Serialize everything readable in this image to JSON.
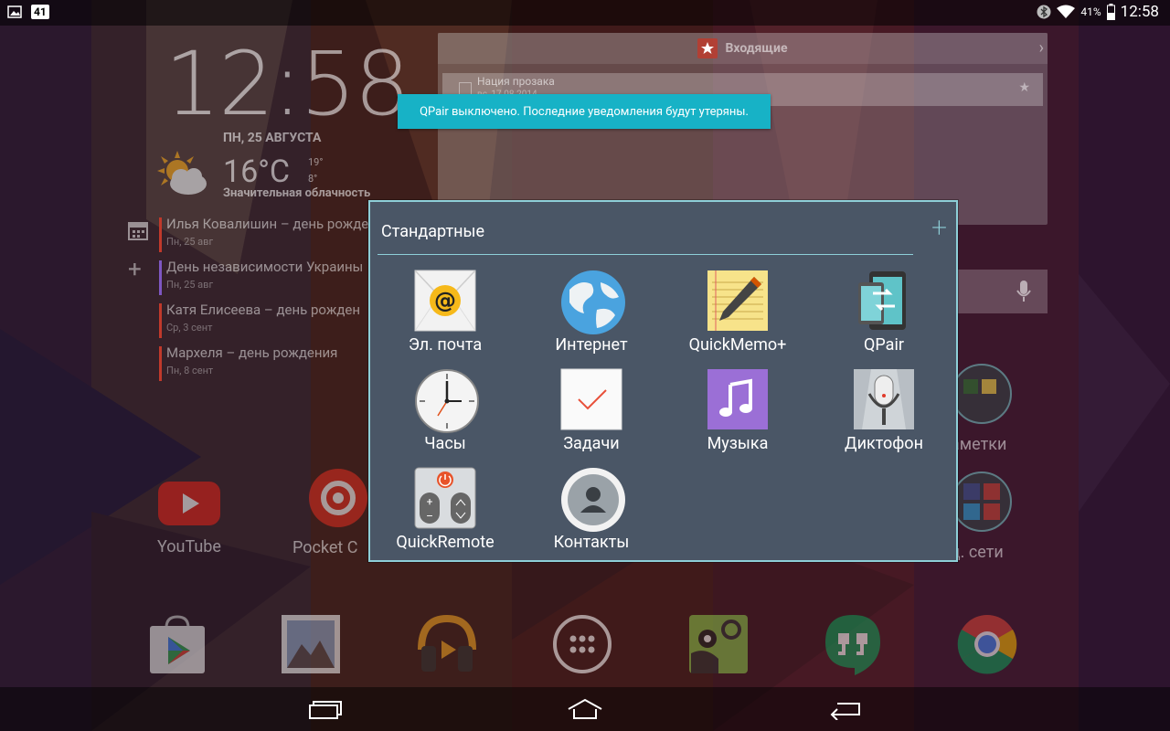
{
  "status_bar": {
    "notification_count": "41",
    "battery": "41%",
    "time": "12:58"
  },
  "clock_widget": {
    "time": "12:58",
    "date": "ПН, 25 АВГУСТА",
    "temperature": "16°C",
    "temp_high": "19°",
    "temp_low": "8°",
    "condition": "Значительная облачность"
  },
  "calendar_events": [
    {
      "title": "Илья Ковалишин – день рожде",
      "date": "Пн, 25 авг",
      "color": "#c0392b"
    },
    {
      "title": "День независимости Украины",
      "date": "Пн, 25 авг",
      "color": "#7e57c2"
    },
    {
      "title": "Катя Елисеева – день рожден",
      "date": "Ср, 3 сент",
      "color": "#c0392b"
    },
    {
      "title": "Мархеля – день рождения",
      "date": "Пн, 8 сент",
      "color": "#c0392b"
    }
  ],
  "inbox_widget": {
    "title": "Входящие",
    "item_title": "Нация прозака",
    "item_date": "вс, 17.08.2014"
  },
  "toast": {
    "message": "QPair выключено. Последние уведомления будут утеряны."
  },
  "folder": {
    "title": "Стандартные",
    "apps": [
      {
        "label": "Эл. почта",
        "icon": "email-icon"
      },
      {
        "label": "Интернет",
        "icon": "globe-icon"
      },
      {
        "label": "QuickMemo+",
        "icon": "memo-icon"
      },
      {
        "label": "QPair",
        "icon": "qpair-icon"
      },
      {
        "label": "Часы",
        "icon": "clock-icon"
      },
      {
        "label": "Задачи",
        "icon": "tasks-icon"
      },
      {
        "label": "Музыка",
        "icon": "music-icon"
      },
      {
        "label": "Диктофон",
        "icon": "microphone-icon"
      },
      {
        "label": "QuickRemote",
        "icon": "remote-icon"
      },
      {
        "label": "Контакты",
        "icon": "contacts-icon"
      }
    ]
  },
  "home_icons": {
    "youtube": "YouTube",
    "pocket": "Pocket C",
    "notes": "аметки",
    "social": "ц. сети"
  },
  "colors": {
    "toast": "#17b2c6",
    "folder_bg": "#4a5666",
    "folder_accent": "#8ecfd8"
  }
}
